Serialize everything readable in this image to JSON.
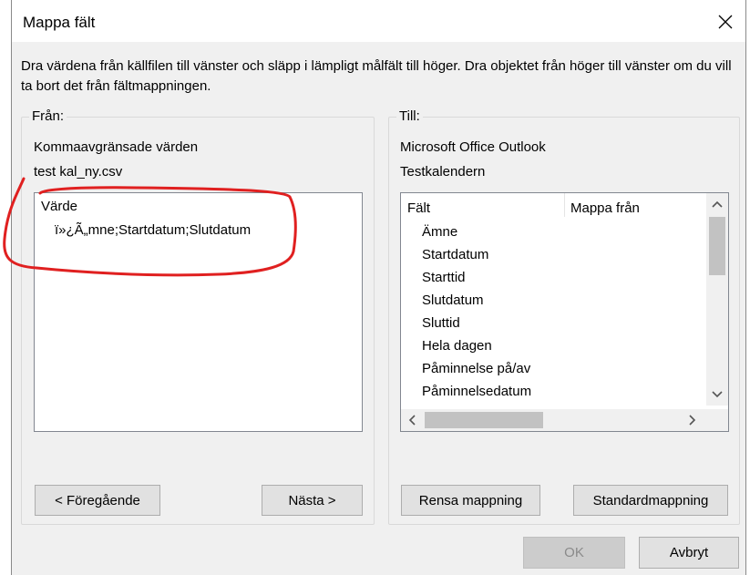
{
  "dialog": {
    "title": "Mappa fält",
    "description": "Dra värdena från källfilen till vänster och släpp i lämpligt målfält till höger. Dra objektet från höger till vänster om du vill ta bort det från fältmappningen."
  },
  "from": {
    "group_label": "Från:",
    "source_type": "Kommaavgränsade värden",
    "file_name": "test kal_ny.csv",
    "list": {
      "header": "Värde",
      "items": [
        "ï»¿Ã„mne;Startdatum;Slutdatum"
      ]
    },
    "prev_button": "< Föregående",
    "next_button": "Nästa >"
  },
  "to": {
    "group_label": "Till:",
    "target_app": "Microsoft Office Outlook",
    "target_folder": "Testkalendern",
    "list": {
      "columns": [
        "Fält",
        "Mappa från"
      ],
      "items": [
        "Ämne",
        "Startdatum",
        "Starttid",
        "Slutdatum",
        "Sluttid",
        "Hela dagen",
        "Påminnelse på/av",
        "Påminnelsedatum"
      ]
    },
    "clear_button": "Rensa mappning",
    "default_button": "Standardmappning"
  },
  "footer": {
    "ok_button": "OK",
    "cancel_button": "Avbryt"
  },
  "annotation": {
    "color": "#e02020"
  },
  "icons": {
    "close": "close-icon",
    "scroll_up": "chevron-up-icon",
    "scroll_down": "chevron-down-icon",
    "scroll_left": "chevron-left-icon",
    "scroll_right": "chevron-right-icon"
  }
}
